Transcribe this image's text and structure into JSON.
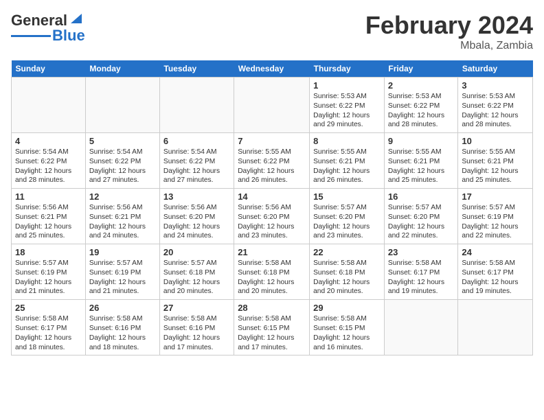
{
  "header": {
    "logo_general": "General",
    "logo_blue": "Blue",
    "month_year": "February 2024",
    "location": "Mbala, Zambia"
  },
  "days_of_week": [
    "Sunday",
    "Monday",
    "Tuesday",
    "Wednesday",
    "Thursday",
    "Friday",
    "Saturday"
  ],
  "weeks": [
    [
      {
        "day": "",
        "sunrise": "",
        "sunset": "",
        "daylight": ""
      },
      {
        "day": "",
        "sunrise": "",
        "sunset": "",
        "daylight": ""
      },
      {
        "day": "",
        "sunrise": "",
        "sunset": "",
        "daylight": ""
      },
      {
        "day": "",
        "sunrise": "",
        "sunset": "",
        "daylight": ""
      },
      {
        "day": "1",
        "sunrise": "Sunrise: 5:53 AM",
        "sunset": "Sunset: 6:22 PM",
        "daylight": "Daylight: 12 hours and 29 minutes."
      },
      {
        "day": "2",
        "sunrise": "Sunrise: 5:53 AM",
        "sunset": "Sunset: 6:22 PM",
        "daylight": "Daylight: 12 hours and 28 minutes."
      },
      {
        "day": "3",
        "sunrise": "Sunrise: 5:53 AM",
        "sunset": "Sunset: 6:22 PM",
        "daylight": "Daylight: 12 hours and 28 minutes."
      }
    ],
    [
      {
        "day": "4",
        "sunrise": "Sunrise: 5:54 AM",
        "sunset": "Sunset: 6:22 PM",
        "daylight": "Daylight: 12 hours and 28 minutes."
      },
      {
        "day": "5",
        "sunrise": "Sunrise: 5:54 AM",
        "sunset": "Sunset: 6:22 PM",
        "daylight": "Daylight: 12 hours and 27 minutes."
      },
      {
        "day": "6",
        "sunrise": "Sunrise: 5:54 AM",
        "sunset": "Sunset: 6:22 PM",
        "daylight": "Daylight: 12 hours and 27 minutes."
      },
      {
        "day": "7",
        "sunrise": "Sunrise: 5:55 AM",
        "sunset": "Sunset: 6:22 PM",
        "daylight": "Daylight: 12 hours and 26 minutes."
      },
      {
        "day": "8",
        "sunrise": "Sunrise: 5:55 AM",
        "sunset": "Sunset: 6:21 PM",
        "daylight": "Daylight: 12 hours and 26 minutes."
      },
      {
        "day": "9",
        "sunrise": "Sunrise: 5:55 AM",
        "sunset": "Sunset: 6:21 PM",
        "daylight": "Daylight: 12 hours and 25 minutes."
      },
      {
        "day": "10",
        "sunrise": "Sunrise: 5:55 AM",
        "sunset": "Sunset: 6:21 PM",
        "daylight": "Daylight: 12 hours and 25 minutes."
      }
    ],
    [
      {
        "day": "11",
        "sunrise": "Sunrise: 5:56 AM",
        "sunset": "Sunset: 6:21 PM",
        "daylight": "Daylight: 12 hours and 25 minutes."
      },
      {
        "day": "12",
        "sunrise": "Sunrise: 5:56 AM",
        "sunset": "Sunset: 6:21 PM",
        "daylight": "Daylight: 12 hours and 24 minutes."
      },
      {
        "day": "13",
        "sunrise": "Sunrise: 5:56 AM",
        "sunset": "Sunset: 6:20 PM",
        "daylight": "Daylight: 12 hours and 24 minutes."
      },
      {
        "day": "14",
        "sunrise": "Sunrise: 5:56 AM",
        "sunset": "Sunset: 6:20 PM",
        "daylight": "Daylight: 12 hours and 23 minutes."
      },
      {
        "day": "15",
        "sunrise": "Sunrise: 5:57 AM",
        "sunset": "Sunset: 6:20 PM",
        "daylight": "Daylight: 12 hours and 23 minutes."
      },
      {
        "day": "16",
        "sunrise": "Sunrise: 5:57 AM",
        "sunset": "Sunset: 6:20 PM",
        "daylight": "Daylight: 12 hours and 22 minutes."
      },
      {
        "day": "17",
        "sunrise": "Sunrise: 5:57 AM",
        "sunset": "Sunset: 6:19 PM",
        "daylight": "Daylight: 12 hours and 22 minutes."
      }
    ],
    [
      {
        "day": "18",
        "sunrise": "Sunrise: 5:57 AM",
        "sunset": "Sunset: 6:19 PM",
        "daylight": "Daylight: 12 hours and 21 minutes."
      },
      {
        "day": "19",
        "sunrise": "Sunrise: 5:57 AM",
        "sunset": "Sunset: 6:19 PM",
        "daylight": "Daylight: 12 hours and 21 minutes."
      },
      {
        "day": "20",
        "sunrise": "Sunrise: 5:57 AM",
        "sunset": "Sunset: 6:18 PM",
        "daylight": "Daylight: 12 hours and 20 minutes."
      },
      {
        "day": "21",
        "sunrise": "Sunrise: 5:58 AM",
        "sunset": "Sunset: 6:18 PM",
        "daylight": "Daylight: 12 hours and 20 minutes."
      },
      {
        "day": "22",
        "sunrise": "Sunrise: 5:58 AM",
        "sunset": "Sunset: 6:18 PM",
        "daylight": "Daylight: 12 hours and 20 minutes."
      },
      {
        "day": "23",
        "sunrise": "Sunrise: 5:58 AM",
        "sunset": "Sunset: 6:17 PM",
        "daylight": "Daylight: 12 hours and 19 minutes."
      },
      {
        "day": "24",
        "sunrise": "Sunrise: 5:58 AM",
        "sunset": "Sunset: 6:17 PM",
        "daylight": "Daylight: 12 hours and 19 minutes."
      }
    ],
    [
      {
        "day": "25",
        "sunrise": "Sunrise: 5:58 AM",
        "sunset": "Sunset: 6:17 PM",
        "daylight": "Daylight: 12 hours and 18 minutes."
      },
      {
        "day": "26",
        "sunrise": "Sunrise: 5:58 AM",
        "sunset": "Sunset: 6:16 PM",
        "daylight": "Daylight: 12 hours and 18 minutes."
      },
      {
        "day": "27",
        "sunrise": "Sunrise: 5:58 AM",
        "sunset": "Sunset: 6:16 PM",
        "daylight": "Daylight: 12 hours and 17 minutes."
      },
      {
        "day": "28",
        "sunrise": "Sunrise: 5:58 AM",
        "sunset": "Sunset: 6:15 PM",
        "daylight": "Daylight: 12 hours and 17 minutes."
      },
      {
        "day": "29",
        "sunrise": "Sunrise: 5:58 AM",
        "sunset": "Sunset: 6:15 PM",
        "daylight": "Daylight: 12 hours and 16 minutes."
      },
      {
        "day": "",
        "sunrise": "",
        "sunset": "",
        "daylight": ""
      },
      {
        "day": "",
        "sunrise": "",
        "sunset": "",
        "daylight": ""
      }
    ]
  ]
}
